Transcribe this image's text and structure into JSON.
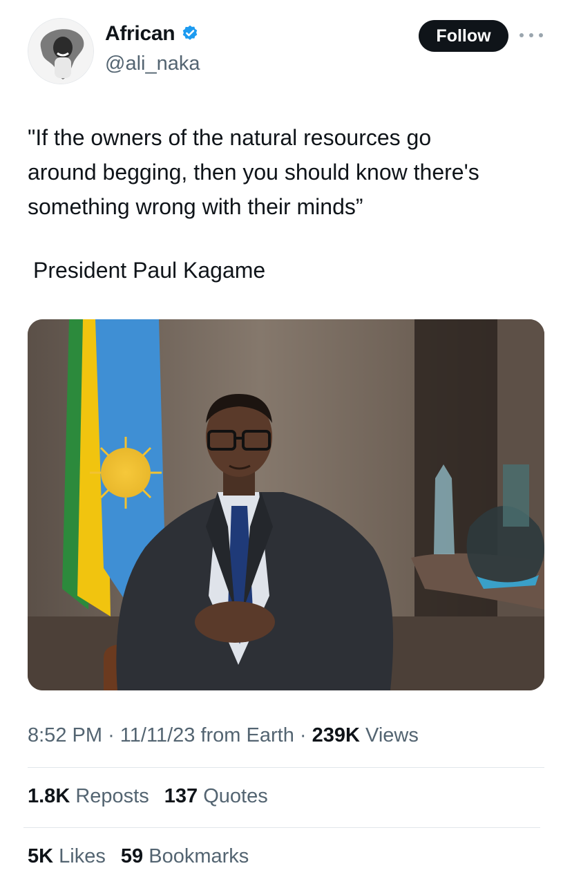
{
  "author": {
    "display_name": "African",
    "handle": "@ali_naka",
    "verified_icon": "verified-badge-icon",
    "verified_color": "#1d9bf0"
  },
  "actions": {
    "follow_label": "Follow",
    "more_icon": "more-options-icon"
  },
  "tweet": {
    "lines": [
      "\"If the owners of the natural resources go",
      "around begging, then you should know there's",
      "something wrong with their minds”"
    ],
    "attribution": "President Paul Kagame"
  },
  "media": {
    "kind": "photo"
  },
  "meta": {
    "time": "8:52 PM",
    "date": "11/11/23",
    "source": "from Earth",
    "separator": "·",
    "views_count": "239K",
    "views_label": "Views"
  },
  "stats": {
    "reposts_count": "1.8K",
    "reposts_label": "Reposts",
    "quotes_count": "137",
    "quotes_label": "Quotes",
    "likes_count": "5K",
    "likes_label": "Likes",
    "bookmarks_count": "59",
    "bookmarks_label": "Bookmarks"
  },
  "colors": {
    "text_primary": "#0f1419",
    "text_secondary": "#536471",
    "follow_bg": "#0f1419",
    "divider": "#e1e6ea"
  }
}
